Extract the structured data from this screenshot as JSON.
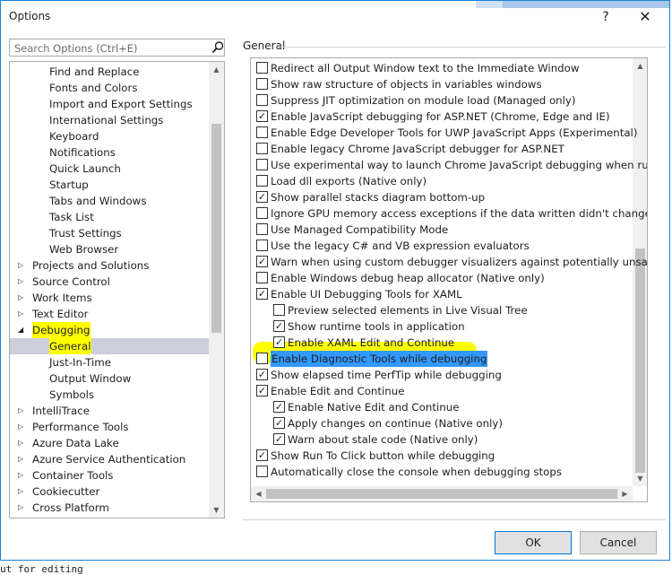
{
  "window": {
    "title": "Options",
    "help_label": "?",
    "close_label": "✕"
  },
  "search": {
    "placeholder": "Search Options (Ctrl+E)"
  },
  "tree": [
    {
      "label": "Find and Replace",
      "level": 2,
      "expand": ""
    },
    {
      "label": "Fonts and Colors",
      "level": 2,
      "expand": ""
    },
    {
      "label": "Import and Export Settings",
      "level": 2,
      "expand": ""
    },
    {
      "label": "International Settings",
      "level": 2,
      "expand": ""
    },
    {
      "label": "Keyboard",
      "level": 2,
      "expand": ""
    },
    {
      "label": "Notifications",
      "level": 2,
      "expand": ""
    },
    {
      "label": "Quick Launch",
      "level": 2,
      "expand": ""
    },
    {
      "label": "Startup",
      "level": 2,
      "expand": ""
    },
    {
      "label": "Tabs and Windows",
      "level": 2,
      "expand": ""
    },
    {
      "label": "Task List",
      "level": 2,
      "expand": ""
    },
    {
      "label": "Trust Settings",
      "level": 2,
      "expand": ""
    },
    {
      "label": "Web Browser",
      "level": 2,
      "expand": ""
    },
    {
      "label": "Projects and Solutions",
      "level": 1,
      "expand": "▷"
    },
    {
      "label": "Source Control",
      "level": 1,
      "expand": "▷"
    },
    {
      "label": "Work Items",
      "level": 1,
      "expand": "▷"
    },
    {
      "label": "Text Editor",
      "level": 1,
      "expand": "▷"
    },
    {
      "label": "Debugging",
      "level": 1,
      "expand": "◢",
      "highlight": true
    },
    {
      "label": "General",
      "level": 2,
      "expand": "",
      "selected": true,
      "highlight": true
    },
    {
      "label": "Just-In-Time",
      "level": 2,
      "expand": ""
    },
    {
      "label": "Output Window",
      "level": 2,
      "expand": ""
    },
    {
      "label": "Symbols",
      "level": 2,
      "expand": ""
    },
    {
      "label": "IntelliTrace",
      "level": 1,
      "expand": "▷"
    },
    {
      "label": "Performance Tools",
      "level": 1,
      "expand": "▷"
    },
    {
      "label": "Azure Data Lake",
      "level": 1,
      "expand": "▷"
    },
    {
      "label": "Azure Service Authentication",
      "level": 1,
      "expand": "▷"
    },
    {
      "label": "Container Tools",
      "level": 1,
      "expand": "▷"
    },
    {
      "label": "Cookiecutter",
      "level": 1,
      "expand": "▷"
    },
    {
      "label": "Cross Platform",
      "level": 1,
      "expand": "▷"
    }
  ],
  "group": {
    "label": "General"
  },
  "options": [
    {
      "label": "Redirect all Output Window text to the Immediate Window",
      "checked": false,
      "indent": 0
    },
    {
      "label": "Show raw structure of objects in variables windows",
      "checked": false,
      "indent": 0
    },
    {
      "label": "Suppress JIT optimization on module load (Managed only)",
      "checked": false,
      "indent": 0
    },
    {
      "label": "Enable JavaScript debugging for ASP.NET (Chrome, Edge and IE)",
      "checked": true,
      "indent": 0
    },
    {
      "label": "Enable Edge Developer Tools for UWP JavaScript Apps (Experimental)",
      "checked": false,
      "indent": 0
    },
    {
      "label": "Enable legacy Chrome JavaScript debugger for ASP.NET",
      "checked": false,
      "indent": 0
    },
    {
      "label": "Use experimental way to launch Chrome JavaScript debugging when running",
      "checked": false,
      "indent": 0
    },
    {
      "label": "Load dll exports (Native only)",
      "checked": false,
      "indent": 0
    },
    {
      "label": "Show parallel stacks diagram bottom-up",
      "checked": true,
      "indent": 0
    },
    {
      "label": "Ignore GPU memory access exceptions if the data written didn't change the v",
      "checked": false,
      "indent": 0
    },
    {
      "label": "Use Managed Compatibility Mode",
      "checked": false,
      "indent": 0
    },
    {
      "label": "Use the legacy C# and VB expression evaluators",
      "checked": false,
      "indent": 0
    },
    {
      "label": "Warn when using custom debugger visualizers against potentially unsafe pro",
      "checked": true,
      "indent": 0
    },
    {
      "label": "Enable Windows debug heap allocator (Native only)",
      "checked": false,
      "indent": 0
    },
    {
      "label": "Enable UI Debugging Tools for XAML",
      "checked": true,
      "indent": 0
    },
    {
      "label": "Preview selected elements in Live Visual Tree",
      "checked": false,
      "indent": 1
    },
    {
      "label": "Show runtime tools in application",
      "checked": true,
      "indent": 1
    },
    {
      "label": "Enable XAML Edit and Continue",
      "checked": true,
      "indent": 1
    },
    {
      "label": "Enable Diagnostic Tools while debugging",
      "checked": false,
      "indent": 0,
      "selected": true
    },
    {
      "label": "Show elapsed time PerfTip while debugging",
      "checked": true,
      "indent": 0
    },
    {
      "label": "Enable Edit and Continue",
      "checked": true,
      "indent": 0
    },
    {
      "label": "Enable Native Edit and Continue",
      "checked": true,
      "indent": 1
    },
    {
      "label": "Apply changes on continue (Native only)",
      "checked": true,
      "indent": 1
    },
    {
      "label": "Warn about stale code (Native only)",
      "checked": true,
      "indent": 1
    },
    {
      "label": "Show Run To Click button while debugging",
      "checked": true,
      "indent": 0
    },
    {
      "label": "Automatically close the console when debugging stops",
      "checked": false,
      "indent": 0
    }
  ],
  "buttons": {
    "ok": "OK",
    "cancel": "Cancel"
  },
  "background_text": "ut for editing",
  "colors": {
    "accent": "#1883d7",
    "selection": "#3399ff",
    "highlight": "#ffff00",
    "tree_selected": "#cccedb"
  }
}
